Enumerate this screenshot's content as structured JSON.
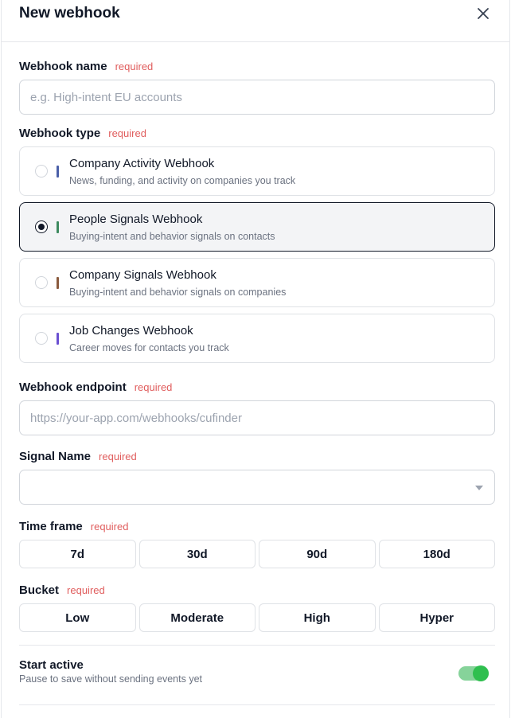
{
  "header": {
    "title": "New webhook"
  },
  "required_text": "required",
  "name_field": {
    "label": "Webhook name",
    "placeholder": "e.g. High-intent EU accounts",
    "value": ""
  },
  "type_field": {
    "label": "Webhook type",
    "selected_index": 1,
    "options": [
      {
        "title": "Company Activity Webhook",
        "desc": "News, funding, and activity on companies you track",
        "color": "#4a5fa8"
      },
      {
        "title": "People Signals Webhook",
        "desc": "Buying-intent and behavior signals on contacts",
        "color": "#3d8a5f"
      },
      {
        "title": "Company Signals Webhook",
        "desc": "Buying-intent and behavior signals on companies",
        "color": "#8a5a3d"
      },
      {
        "title": "Job Changes Webhook",
        "desc": "Career moves for contacts you track",
        "color": "#6a4fd1"
      }
    ]
  },
  "endpoint_field": {
    "label": "Webhook endpoint",
    "placeholder": "https://your-app.com/webhooks/cufinder",
    "value": ""
  },
  "signal_field": {
    "label": "Signal Name",
    "value": ""
  },
  "timeframe": {
    "label": "Time frame",
    "options": [
      "7d",
      "30d",
      "90d",
      "180d"
    ]
  },
  "bucket": {
    "label": "Bucket",
    "options": [
      "Low",
      "Moderate",
      "High",
      "Hyper"
    ]
  },
  "start_active": {
    "label": "Start active",
    "sub": "Pause to save without sending events yet",
    "enabled": true
  },
  "colors": {
    "accent": "#2fbf4f",
    "required": "#e05d5d",
    "selected_border": "#111827"
  }
}
